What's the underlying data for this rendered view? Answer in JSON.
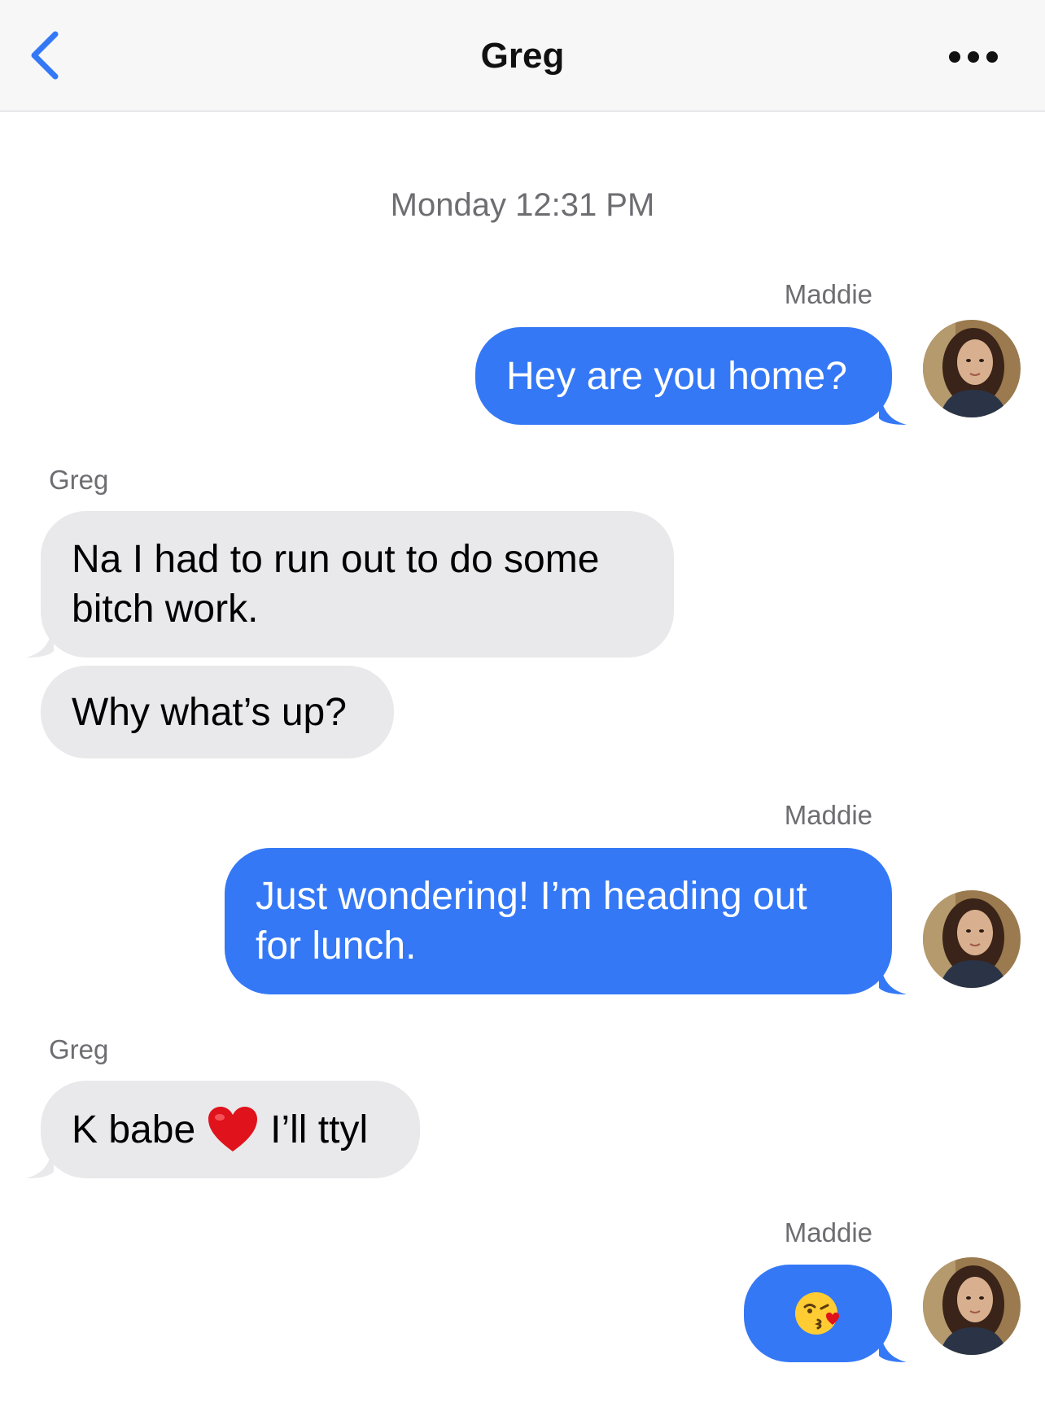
{
  "nav": {
    "back_icon": "chevron-left-icon",
    "title": "Greg",
    "more_icon": "ellipsis-icon"
  },
  "timestamp": "Monday 12:31 PM",
  "colors": {
    "accent": "#3478f6",
    "incoming_bubble": "#e9e9eb",
    "meta_text": "#6d6d72"
  },
  "messages": [
    {
      "sender": "Maddie",
      "direction": "outgoing",
      "lines": [
        "Hey are you home?"
      ]
    },
    {
      "sender": "Greg",
      "direction": "incoming",
      "lines": [
        "Na I had to run out to do some",
        "bitch work."
      ]
    },
    {
      "direction": "incoming",
      "lines": [
        "Why what’s up?"
      ]
    },
    {
      "sender": "Maddie",
      "direction": "outgoing",
      "lines": [
        "Just wondering! I’m heading out",
        "for lunch."
      ]
    },
    {
      "sender": "Greg",
      "direction": "incoming",
      "parts": [
        "K babe",
        "I’ll ttyl"
      ],
      "emoji": "red-heart-icon"
    },
    {
      "sender": "Maddie",
      "direction": "outgoing",
      "emoji": "face-blowing-kiss-icon"
    }
  ]
}
